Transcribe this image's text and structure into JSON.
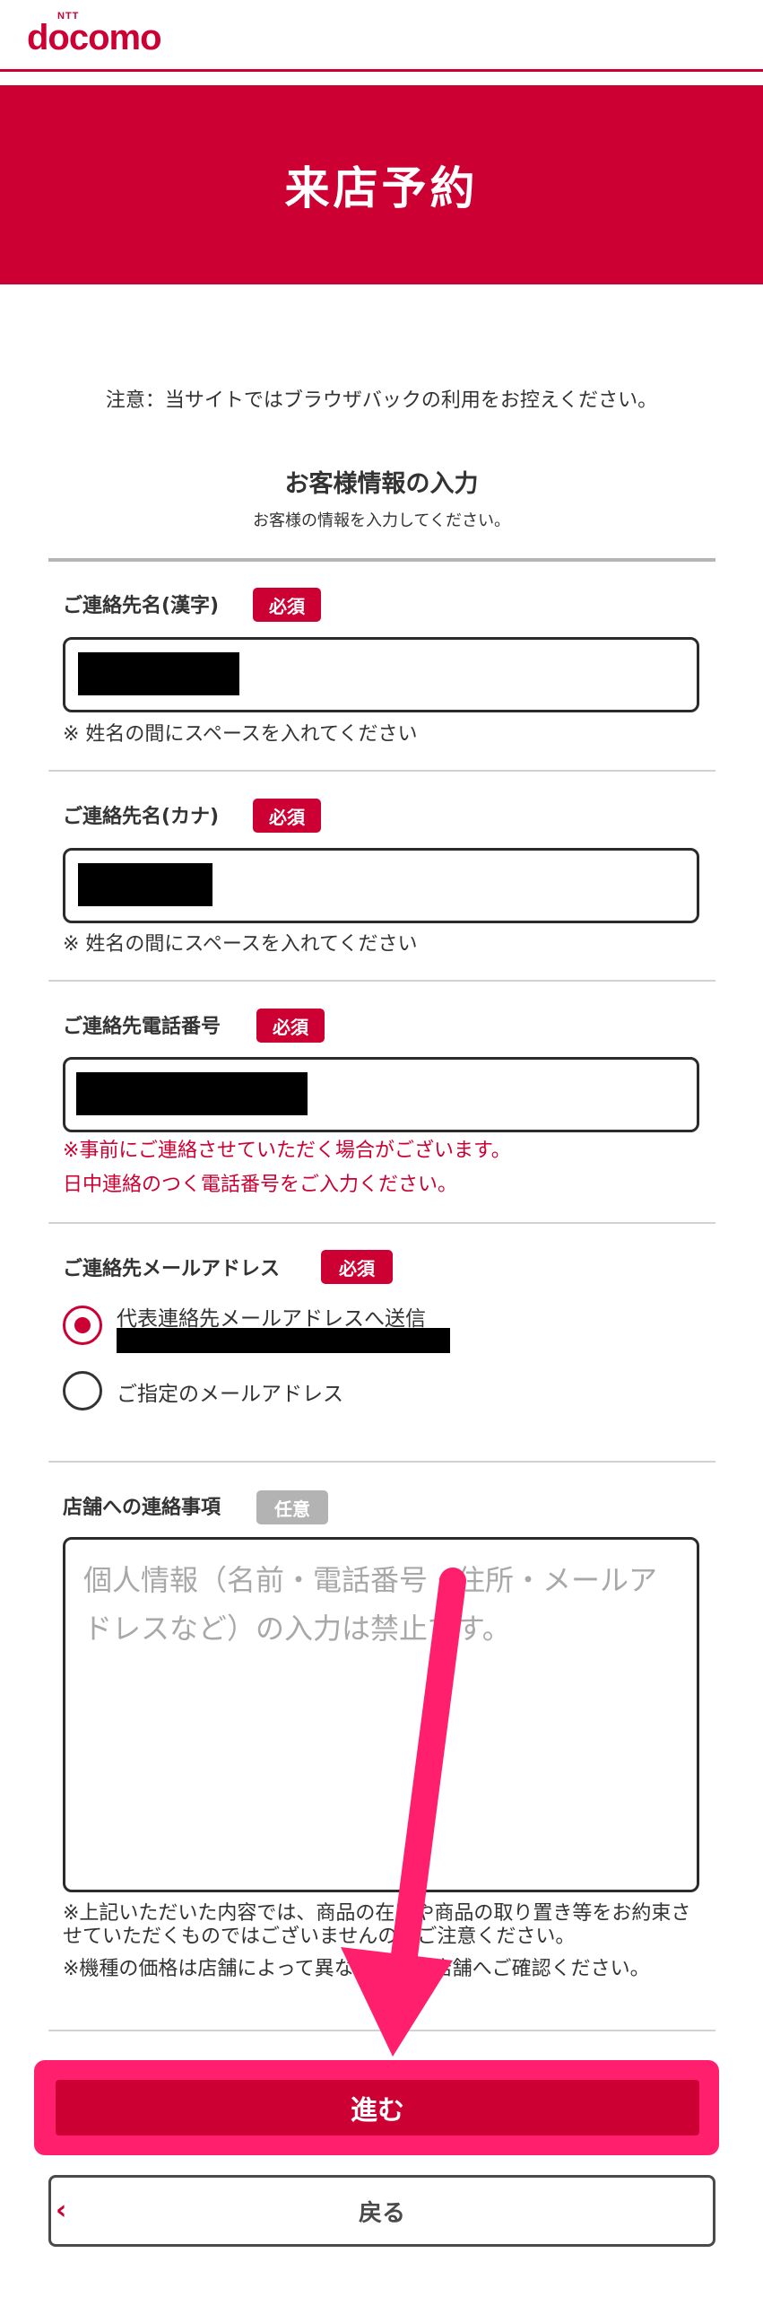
{
  "header": {
    "logo_small": "NTT",
    "logo_word": "docomo"
  },
  "banner": {
    "title": "来店予約"
  },
  "notice": "注意：当サイトではブラウザバックの利用をお控えください。",
  "section": {
    "title": "お客様情報の入力",
    "subtitle": "お客様の情報を入力してください。"
  },
  "fields": {
    "name_kanji": {
      "label": "ご連絡先名(漢字)",
      "badge": "必須",
      "hint": "※ 姓名の間にスペースを入れてください"
    },
    "name_kana": {
      "label": "ご連絡先名(カナ)",
      "badge": "必須",
      "hint": "※ 姓名の間にスペースを入れてください"
    },
    "phone": {
      "label": "ご連絡先電話番号",
      "badge": "必須",
      "warn1": "※事前にご連絡させていただく場合がございます。",
      "warn2": "日中連絡のつく電話番号をご入力ください。"
    },
    "email": {
      "label": "ご連絡先メールアドレス",
      "badge": "必須",
      "option1": "代表連絡先メールアドレスへ送信",
      "option2": "ご指定のメールアドレス",
      "selected": "option1"
    },
    "store_message": {
      "label": "店舗への連絡事項",
      "badge": "任意",
      "placeholder": "個人情報（名前・電話番号・住所・メールアドレスなど）の入力は禁止です。"
    }
  },
  "notes": {
    "note1": "※上記いただいた内容では、商品の在庫や商品の取り置き等をお約束させていただくものではございませんのでご注意ください。",
    "note2": "※機種の価格は店舗によって異なるため、店舗へご確認ください。"
  },
  "buttons": {
    "submit": "進む",
    "back": "戻る"
  },
  "colors": {
    "brand_red": "#cc0033",
    "highlight_pink": "#ff1f6d",
    "optional_gray": "#b3b3b3"
  }
}
